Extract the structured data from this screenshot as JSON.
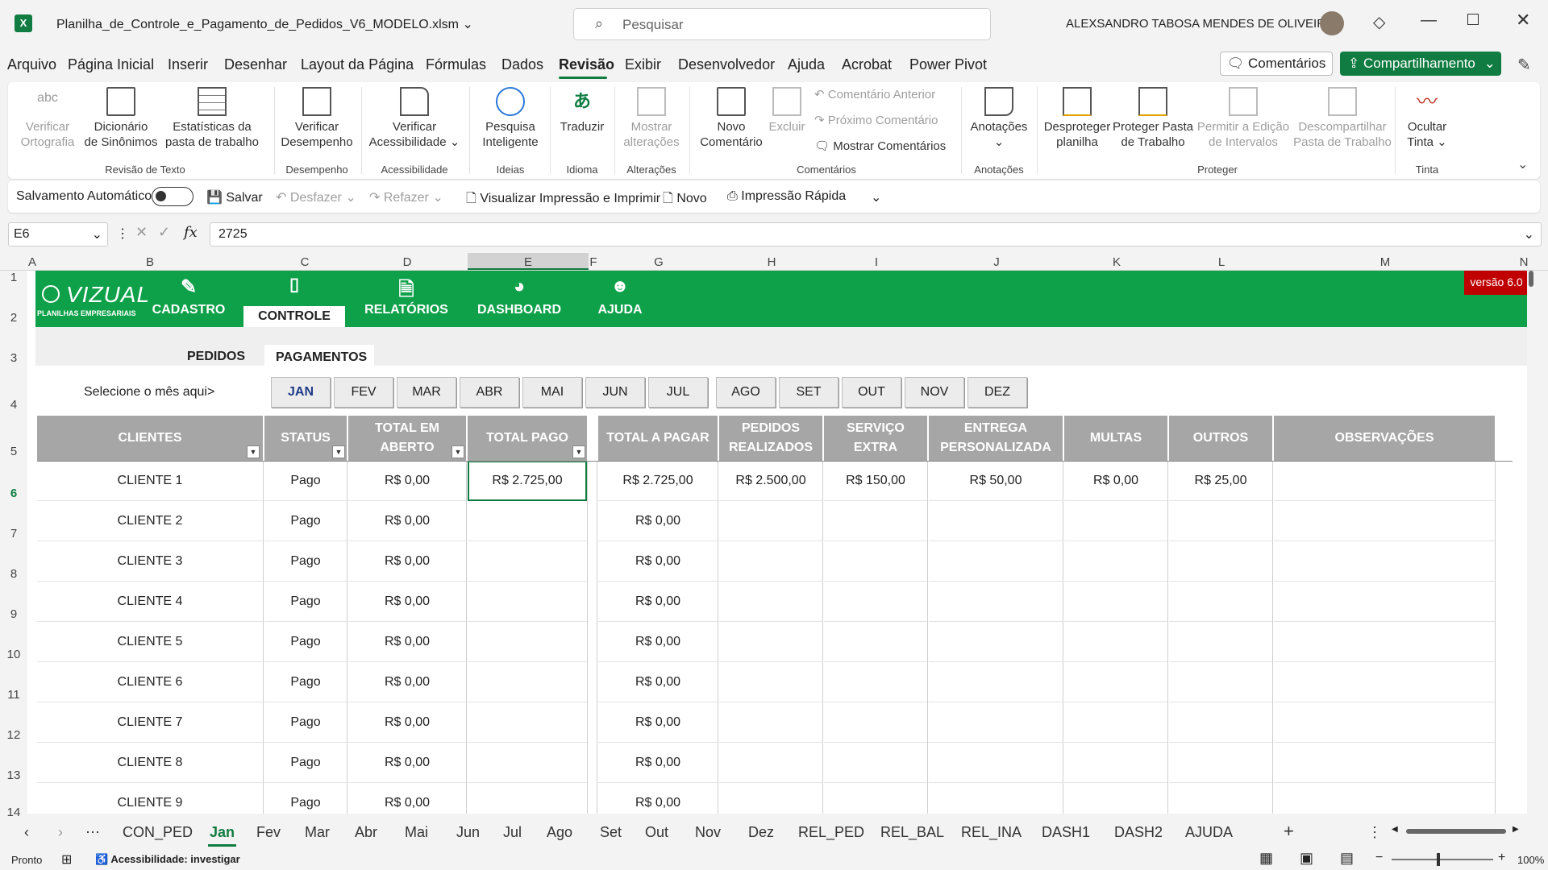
{
  "titlebar": {
    "filename": "Planilha_de_Controle_e_Pagamento_de_Pedidos_V6_MODELO.xlsm",
    "search_placeholder": "Pesquisar",
    "user": "ALEXSANDRO TABOSA MENDES DE OLIVEIRA"
  },
  "menu": {
    "tabs": [
      "Arquivo",
      "Página Inicial",
      "Inserir",
      "Desenhar",
      "Layout da Página",
      "Fórmulas",
      "Dados",
      "Revisão",
      "Exibir",
      "Desenvolvedor",
      "Ajuda",
      "Acrobat",
      "Power Pivot"
    ],
    "active": "Revisão",
    "comments_btn": "Comentários",
    "share_btn": "Compartilhamento"
  },
  "ribbon": {
    "spelling": [
      "Verificar",
      "Ortografia"
    ],
    "thesaurus": [
      "Dicionário",
      "de Sinônimos"
    ],
    "stats": [
      "Estatísticas da",
      "pasta de trabalho"
    ],
    "group_review": "Revisão de Texto",
    "perf": [
      "Verificar",
      "Desempenho"
    ],
    "group_perf": "Desempenho",
    "access": [
      "Verificar",
      "Acessibilidade"
    ],
    "group_access": "Acessibilidade",
    "smart": [
      "Pesquisa",
      "Inteligente"
    ],
    "group_ideas": "Ideias",
    "translate": "Traduzir",
    "group_lang": "Idioma",
    "changes": [
      "Mostrar",
      "alterações"
    ],
    "group_changes": "Alterações",
    "newcomment": [
      "Novo",
      "Comentário"
    ],
    "delete": "Excluir",
    "prev": "Comentário Anterior",
    "next": "Próximo Comentário",
    "show": "Mostrar Comentários",
    "group_comments": "Comentários",
    "notes": "Anotações",
    "group_notes": "Anotações",
    "unprotect": [
      "Desproteger",
      "planilha"
    ],
    "protectwb": [
      "Proteger Pasta",
      "de Trabalho"
    ],
    "allowedit": [
      "Permitir a Edição",
      "de Intervalos"
    ],
    "unshare": [
      "Descompartilhar",
      "Pasta de Trabalho"
    ],
    "group_protect": "Proteger",
    "hideink": [
      "Ocultar",
      "Tinta"
    ],
    "group_ink": "Tinta"
  },
  "qat": {
    "autosave": "Salvamento Automático",
    "save": "Salvar",
    "undo": "Desfazer",
    "redo": "Refazer",
    "print": "Visualizar Impressão e Imprimir",
    "new": "Novo",
    "quickprint": "Impressão Rápida"
  },
  "formula": {
    "namebox": "E6",
    "value": "2725"
  },
  "columns": [
    "A",
    "B",
    "C",
    "D",
    "E",
    "F",
    "G",
    "H",
    "I",
    "J",
    "K",
    "L",
    "M",
    "N"
  ],
  "rows": [
    "1",
    "2",
    "3",
    "4",
    "5",
    "6",
    "7",
    "8",
    "9",
    "10",
    "11",
    "12",
    "13",
    "14"
  ],
  "app": {
    "logo": "VIZUAL",
    "logo_sub": "PLANILHAS EMPRESARIAIS",
    "version": "versão 6.0",
    "nav": [
      "CADASTRO",
      "CONTROLE",
      "RELATÓRIOS",
      "DASHBOARD",
      "AJUDA"
    ],
    "subtabs": [
      "PEDIDOS",
      "PAGAMENTOS"
    ],
    "select_month": "Selecione o mês aqui>",
    "months": [
      "JAN",
      "FEV",
      "MAR",
      "ABR",
      "MAI",
      "JUN",
      "JUL",
      "AGO",
      "SET",
      "OUT",
      "NOV",
      "DEZ"
    ],
    "headers": [
      "CLIENTES",
      "STATUS",
      "TOTAL EM\nABERTO",
      "TOTAL PAGO",
      "TOTAL A PAGAR",
      "PEDIDOS\nREALIZADOS",
      "SERVIÇO EXTRA",
      "ENTREGA\nPERSONALIZADA",
      "MULTAS",
      "OUTROS",
      "OBSERVAÇÕES"
    ],
    "rows": [
      [
        "CLIENTE 1",
        "Pago",
        "R$ 0,00",
        "R$ 2.725,00",
        "R$ 2.725,00",
        "R$ 2.500,00",
        "R$ 150,00",
        "R$ 50,00",
        "R$ 0,00",
        "R$ 25,00",
        ""
      ],
      [
        "CLIENTE 2",
        "Pago",
        "R$ 0,00",
        "",
        "R$ 0,00",
        "",
        "",
        "",
        "",
        "",
        ""
      ],
      [
        "CLIENTE 3",
        "Pago",
        "R$ 0,00",
        "",
        "R$ 0,00",
        "",
        "",
        "",
        "",
        "",
        ""
      ],
      [
        "CLIENTE 4",
        "Pago",
        "R$ 0,00",
        "",
        "R$ 0,00",
        "",
        "",
        "",
        "",
        "",
        ""
      ],
      [
        "CLIENTE 5",
        "Pago",
        "R$ 0,00",
        "",
        "R$ 0,00",
        "",
        "",
        "",
        "",
        "",
        ""
      ],
      [
        "CLIENTE 6",
        "Pago",
        "R$ 0,00",
        "",
        "R$ 0,00",
        "",
        "",
        "",
        "",
        "",
        ""
      ],
      [
        "CLIENTE 7",
        "Pago",
        "R$ 0,00",
        "",
        "R$ 0,00",
        "",
        "",
        "",
        "",
        "",
        ""
      ],
      [
        "CLIENTE 8",
        "Pago",
        "R$ 0,00",
        "",
        "R$ 0,00",
        "",
        "",
        "",
        "",
        "",
        ""
      ],
      [
        "CLIENTE 9",
        "Pago",
        "R$ 0,00",
        "",
        "R$ 0,00",
        "",
        "",
        "",
        "",
        "",
        ""
      ]
    ]
  },
  "sheets": [
    "CON_PED",
    "Jan",
    "Fev",
    "Mar",
    "Abr",
    "Mai",
    "Jun",
    "Jul",
    "Ago",
    "Set",
    "Out",
    "Nov",
    "Dez",
    "REL_PED",
    "REL_BAL",
    "REL_INA",
    "DASH1",
    "DASH2",
    "AJUDA"
  ],
  "active_sheet": "Jan",
  "status": {
    "ready": "Pronto",
    "accessibility": "Acessibilidade: investigar",
    "zoom": "100%"
  },
  "colors": {
    "green": "#0fa14a",
    "accent": "#107c41",
    "header_gray": "#a6a6a6",
    "version_red": "#c00000"
  }
}
